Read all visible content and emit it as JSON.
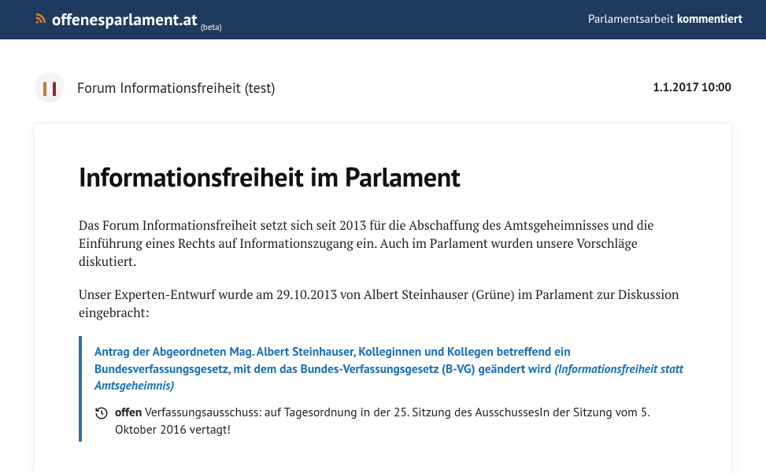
{
  "header": {
    "brand_name": "offenesparlament.at",
    "brand_beta": "(beta)",
    "tagline_prefix": "Parlamentsarbeit ",
    "tagline_bold": "kommentiert"
  },
  "meta": {
    "author": "Forum Informationsfreiheit (test)",
    "timestamp": "1.1.2017 10:00"
  },
  "article": {
    "title": "Informationsfreiheit im Parlament",
    "p1": "Das Forum Informationsfreiheit setzt sich seit 2013 für die Abschaffung des Amtsgeheimnisses und die Einführung eines Rechts auf Informationszugang ein. Auch im Parlament wurden unsere Vorschläge diskutiert.",
    "p2": "Unser Experten-Entwurf wurde am 29.10.2013 von Albert Steinhauser (Grüne) im Parlament zur Diskussion eingebracht:"
  },
  "callout": {
    "link_main": "Antrag der Abgeordneten Mag. Albert Steinhauser, Kolleginnen und Kollegen betreffend ein Bundesverfassungsgesetz, mit dem das Bundes-Verfassungsgesetz (B-VG) geändert wird ",
    "link_suffix": "(Informationsfreiheit statt Amtsgeheimnis)",
    "status_label": "offen",
    "status_text": " Verfassungsausschuss: auf Tagesordnung in der 25. Sitzung des AusschussesIn der Sitzung vom 5. Oktober 2016 vertagt!"
  }
}
